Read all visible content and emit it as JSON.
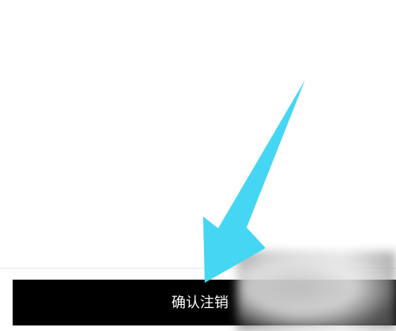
{
  "confirm_button": {
    "label": "确认注销"
  },
  "colors": {
    "button_background": "#000000",
    "button_text": "#ffffff",
    "arrow": "#45d6f4",
    "page_background": "#ffffff"
  },
  "icons": {
    "pointer": "arrow-icon"
  }
}
